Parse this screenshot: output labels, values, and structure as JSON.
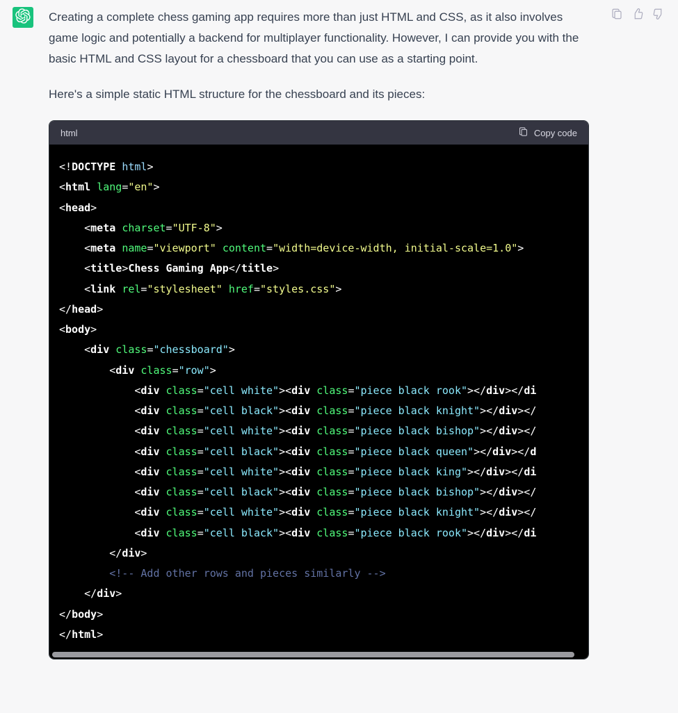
{
  "message": {
    "paragraph1": "Creating a complete chess gaming app requires more than just HTML and CSS, as it also involves game logic and potentially a backend for multiplayer functionality. However, I can provide you with the basic HTML and CSS layout for a chessboard that you can use as a starting point.",
    "paragraph2": "Here's a simple static HTML structure for the chessboard and its pieces:"
  },
  "code_block": {
    "language": "html",
    "copy_label": "Copy code",
    "lines": [
      [
        {
          "cls": "tok-punct",
          "t": "<!"
        },
        {
          "cls": "tok-tagw",
          "t": "DOCTYPE "
        },
        {
          "cls": "tok-doctype",
          "t": "html"
        },
        {
          "cls": "tok-punct",
          "t": ">"
        }
      ],
      [
        {
          "cls": "tok-punct",
          "t": "<"
        },
        {
          "cls": "tok-tagw",
          "t": "html"
        },
        {
          "cls": "",
          "t": " "
        },
        {
          "cls": "tok-attr",
          "t": "lang"
        },
        {
          "cls": "tok-punct",
          "t": "="
        },
        {
          "cls": "tok-val",
          "t": "\"en\""
        },
        {
          "cls": "tok-punct",
          "t": ">"
        }
      ],
      [
        {
          "cls": "tok-punct",
          "t": "<"
        },
        {
          "cls": "tok-tagw",
          "t": "head"
        },
        {
          "cls": "tok-punct",
          "t": ">"
        }
      ],
      [
        {
          "cls": "",
          "t": "    "
        },
        {
          "cls": "tok-punct",
          "t": "<"
        },
        {
          "cls": "tok-tagw",
          "t": "meta"
        },
        {
          "cls": "",
          "t": " "
        },
        {
          "cls": "tok-attr",
          "t": "charset"
        },
        {
          "cls": "tok-punct",
          "t": "="
        },
        {
          "cls": "tok-val",
          "t": "\"UTF-8\""
        },
        {
          "cls": "tok-punct",
          "t": ">"
        }
      ],
      [
        {
          "cls": "",
          "t": "    "
        },
        {
          "cls": "tok-punct",
          "t": "<"
        },
        {
          "cls": "tok-tagw",
          "t": "meta"
        },
        {
          "cls": "",
          "t": " "
        },
        {
          "cls": "tok-attr",
          "t": "name"
        },
        {
          "cls": "tok-punct",
          "t": "="
        },
        {
          "cls": "tok-val",
          "t": "\"viewport\""
        },
        {
          "cls": "",
          "t": " "
        },
        {
          "cls": "tok-attr",
          "t": "content"
        },
        {
          "cls": "tok-punct",
          "t": "="
        },
        {
          "cls": "tok-val",
          "t": "\"width=device-width, initial-scale=1.0\""
        },
        {
          "cls": "tok-punct",
          "t": ">"
        }
      ],
      [
        {
          "cls": "",
          "t": "    "
        },
        {
          "cls": "tok-punct",
          "t": "<"
        },
        {
          "cls": "tok-tagw",
          "t": "title"
        },
        {
          "cls": "tok-punct",
          "t": ">"
        },
        {
          "cls": "tok-text",
          "t": "Chess Gaming App"
        },
        {
          "cls": "tok-punct",
          "t": "</"
        },
        {
          "cls": "tok-tagw",
          "t": "title"
        },
        {
          "cls": "tok-punct",
          "t": ">"
        }
      ],
      [
        {
          "cls": "",
          "t": "    "
        },
        {
          "cls": "tok-punct",
          "t": "<"
        },
        {
          "cls": "tok-tagw",
          "t": "link"
        },
        {
          "cls": "",
          "t": " "
        },
        {
          "cls": "tok-attr",
          "t": "rel"
        },
        {
          "cls": "tok-punct",
          "t": "="
        },
        {
          "cls": "tok-val",
          "t": "\"stylesheet\""
        },
        {
          "cls": "",
          "t": " "
        },
        {
          "cls": "tok-attr",
          "t": "href"
        },
        {
          "cls": "tok-punct",
          "t": "="
        },
        {
          "cls": "tok-val",
          "t": "\"styles.css\""
        },
        {
          "cls": "tok-punct",
          "t": ">"
        }
      ],
      [
        {
          "cls": "tok-punct",
          "t": "</"
        },
        {
          "cls": "tok-tagw",
          "t": "head"
        },
        {
          "cls": "tok-punct",
          "t": ">"
        }
      ],
      [
        {
          "cls": "tok-punct",
          "t": "<"
        },
        {
          "cls": "tok-tagw",
          "t": "body"
        },
        {
          "cls": "tok-punct",
          "t": ">"
        }
      ],
      [
        {
          "cls": "",
          "t": "    "
        },
        {
          "cls": "tok-punct",
          "t": "<"
        },
        {
          "cls": "tok-tagw",
          "t": "div"
        },
        {
          "cls": "",
          "t": " "
        },
        {
          "cls": "tok-attr",
          "t": "class"
        },
        {
          "cls": "tok-punct",
          "t": "="
        },
        {
          "cls": "tok-valc",
          "t": "\"chessboard\""
        },
        {
          "cls": "tok-punct",
          "t": ">"
        }
      ],
      [
        {
          "cls": "",
          "t": "        "
        },
        {
          "cls": "tok-punct",
          "t": "<"
        },
        {
          "cls": "tok-tagw",
          "t": "div"
        },
        {
          "cls": "",
          "t": " "
        },
        {
          "cls": "tok-attr",
          "t": "class"
        },
        {
          "cls": "tok-punct",
          "t": "="
        },
        {
          "cls": "tok-valc",
          "t": "\"row\""
        },
        {
          "cls": "tok-punct",
          "t": ">"
        }
      ],
      [
        {
          "cls": "",
          "t": "            "
        },
        {
          "cls": "tok-punct",
          "t": "<"
        },
        {
          "cls": "tok-tagw",
          "t": "div"
        },
        {
          "cls": "",
          "t": " "
        },
        {
          "cls": "tok-attr",
          "t": "class"
        },
        {
          "cls": "tok-punct",
          "t": "="
        },
        {
          "cls": "tok-valc",
          "t": "\"cell white\""
        },
        {
          "cls": "tok-punct",
          "t": "><"
        },
        {
          "cls": "tok-tagw",
          "t": "div"
        },
        {
          "cls": "",
          "t": " "
        },
        {
          "cls": "tok-attr",
          "t": "class"
        },
        {
          "cls": "tok-punct",
          "t": "="
        },
        {
          "cls": "tok-valc",
          "t": "\"piece black rook\""
        },
        {
          "cls": "tok-punct",
          "t": "></"
        },
        {
          "cls": "tok-tagw",
          "t": "div"
        },
        {
          "cls": "tok-punct",
          "t": "></"
        },
        {
          "cls": "tok-tagw",
          "t": "di"
        }
      ],
      [
        {
          "cls": "",
          "t": "            "
        },
        {
          "cls": "tok-punct",
          "t": "<"
        },
        {
          "cls": "tok-tagw",
          "t": "div"
        },
        {
          "cls": "",
          "t": " "
        },
        {
          "cls": "tok-attr",
          "t": "class"
        },
        {
          "cls": "tok-punct",
          "t": "="
        },
        {
          "cls": "tok-valc",
          "t": "\"cell black\""
        },
        {
          "cls": "tok-punct",
          "t": "><"
        },
        {
          "cls": "tok-tagw",
          "t": "div"
        },
        {
          "cls": "",
          "t": " "
        },
        {
          "cls": "tok-attr",
          "t": "class"
        },
        {
          "cls": "tok-punct",
          "t": "="
        },
        {
          "cls": "tok-valc",
          "t": "\"piece black knight\""
        },
        {
          "cls": "tok-punct",
          "t": "></"
        },
        {
          "cls": "tok-tagw",
          "t": "div"
        },
        {
          "cls": "tok-punct",
          "t": "></"
        }
      ],
      [
        {
          "cls": "",
          "t": "            "
        },
        {
          "cls": "tok-punct",
          "t": "<"
        },
        {
          "cls": "tok-tagw",
          "t": "div"
        },
        {
          "cls": "",
          "t": " "
        },
        {
          "cls": "tok-attr",
          "t": "class"
        },
        {
          "cls": "tok-punct",
          "t": "="
        },
        {
          "cls": "tok-valc",
          "t": "\"cell white\""
        },
        {
          "cls": "tok-punct",
          "t": "><"
        },
        {
          "cls": "tok-tagw",
          "t": "div"
        },
        {
          "cls": "",
          "t": " "
        },
        {
          "cls": "tok-attr",
          "t": "class"
        },
        {
          "cls": "tok-punct",
          "t": "="
        },
        {
          "cls": "tok-valc",
          "t": "\"piece black bishop\""
        },
        {
          "cls": "tok-punct",
          "t": "></"
        },
        {
          "cls": "tok-tagw",
          "t": "div"
        },
        {
          "cls": "tok-punct",
          "t": "></"
        }
      ],
      [
        {
          "cls": "",
          "t": "            "
        },
        {
          "cls": "tok-punct",
          "t": "<"
        },
        {
          "cls": "tok-tagw",
          "t": "div"
        },
        {
          "cls": "",
          "t": " "
        },
        {
          "cls": "tok-attr",
          "t": "class"
        },
        {
          "cls": "tok-punct",
          "t": "="
        },
        {
          "cls": "tok-valc",
          "t": "\"cell black\""
        },
        {
          "cls": "tok-punct",
          "t": "><"
        },
        {
          "cls": "tok-tagw",
          "t": "div"
        },
        {
          "cls": "",
          "t": " "
        },
        {
          "cls": "tok-attr",
          "t": "class"
        },
        {
          "cls": "tok-punct",
          "t": "="
        },
        {
          "cls": "tok-valc",
          "t": "\"piece black queen\""
        },
        {
          "cls": "tok-punct",
          "t": "></"
        },
        {
          "cls": "tok-tagw",
          "t": "div"
        },
        {
          "cls": "tok-punct",
          "t": "></"
        },
        {
          "cls": "tok-tagw",
          "t": "d"
        }
      ],
      [
        {
          "cls": "",
          "t": "            "
        },
        {
          "cls": "tok-punct",
          "t": "<"
        },
        {
          "cls": "tok-tagw",
          "t": "div"
        },
        {
          "cls": "",
          "t": " "
        },
        {
          "cls": "tok-attr",
          "t": "class"
        },
        {
          "cls": "tok-punct",
          "t": "="
        },
        {
          "cls": "tok-valc",
          "t": "\"cell white\""
        },
        {
          "cls": "tok-punct",
          "t": "><"
        },
        {
          "cls": "tok-tagw",
          "t": "div"
        },
        {
          "cls": "",
          "t": " "
        },
        {
          "cls": "tok-attr",
          "t": "class"
        },
        {
          "cls": "tok-punct",
          "t": "="
        },
        {
          "cls": "tok-valc",
          "t": "\"piece black king\""
        },
        {
          "cls": "tok-punct",
          "t": "></"
        },
        {
          "cls": "tok-tagw",
          "t": "div"
        },
        {
          "cls": "tok-punct",
          "t": "></"
        },
        {
          "cls": "tok-tagw",
          "t": "di"
        }
      ],
      [
        {
          "cls": "",
          "t": "            "
        },
        {
          "cls": "tok-punct",
          "t": "<"
        },
        {
          "cls": "tok-tagw",
          "t": "div"
        },
        {
          "cls": "",
          "t": " "
        },
        {
          "cls": "tok-attr",
          "t": "class"
        },
        {
          "cls": "tok-punct",
          "t": "="
        },
        {
          "cls": "tok-valc",
          "t": "\"cell black\""
        },
        {
          "cls": "tok-punct",
          "t": "><"
        },
        {
          "cls": "tok-tagw",
          "t": "div"
        },
        {
          "cls": "",
          "t": " "
        },
        {
          "cls": "tok-attr",
          "t": "class"
        },
        {
          "cls": "tok-punct",
          "t": "="
        },
        {
          "cls": "tok-valc",
          "t": "\"piece black bishop\""
        },
        {
          "cls": "tok-punct",
          "t": "></"
        },
        {
          "cls": "tok-tagw",
          "t": "div"
        },
        {
          "cls": "tok-punct",
          "t": "></"
        }
      ],
      [
        {
          "cls": "",
          "t": "            "
        },
        {
          "cls": "tok-punct",
          "t": "<"
        },
        {
          "cls": "tok-tagw",
          "t": "div"
        },
        {
          "cls": "",
          "t": " "
        },
        {
          "cls": "tok-attr",
          "t": "class"
        },
        {
          "cls": "tok-punct",
          "t": "="
        },
        {
          "cls": "tok-valc",
          "t": "\"cell white\""
        },
        {
          "cls": "tok-punct",
          "t": "><"
        },
        {
          "cls": "tok-tagw",
          "t": "div"
        },
        {
          "cls": "",
          "t": " "
        },
        {
          "cls": "tok-attr",
          "t": "class"
        },
        {
          "cls": "tok-punct",
          "t": "="
        },
        {
          "cls": "tok-valc",
          "t": "\"piece black knight\""
        },
        {
          "cls": "tok-punct",
          "t": "></"
        },
        {
          "cls": "tok-tagw",
          "t": "div"
        },
        {
          "cls": "tok-punct",
          "t": "></"
        }
      ],
      [
        {
          "cls": "",
          "t": "            "
        },
        {
          "cls": "tok-punct",
          "t": "<"
        },
        {
          "cls": "tok-tagw",
          "t": "div"
        },
        {
          "cls": "",
          "t": " "
        },
        {
          "cls": "tok-attr",
          "t": "class"
        },
        {
          "cls": "tok-punct",
          "t": "="
        },
        {
          "cls": "tok-valc",
          "t": "\"cell black\""
        },
        {
          "cls": "tok-punct",
          "t": "><"
        },
        {
          "cls": "tok-tagw",
          "t": "div"
        },
        {
          "cls": "",
          "t": " "
        },
        {
          "cls": "tok-attr",
          "t": "class"
        },
        {
          "cls": "tok-punct",
          "t": "="
        },
        {
          "cls": "tok-valc",
          "t": "\"piece black rook\""
        },
        {
          "cls": "tok-punct",
          "t": "></"
        },
        {
          "cls": "tok-tagw",
          "t": "div"
        },
        {
          "cls": "tok-punct",
          "t": "></"
        },
        {
          "cls": "tok-tagw",
          "t": "di"
        }
      ],
      [
        {
          "cls": "",
          "t": "        "
        },
        {
          "cls": "tok-punct",
          "t": "</"
        },
        {
          "cls": "tok-tagw",
          "t": "div"
        },
        {
          "cls": "tok-punct",
          "t": ">"
        }
      ],
      [
        {
          "cls": "",
          "t": "        "
        },
        {
          "cls": "tok-comment",
          "t": "<!-- Add other rows and pieces similarly -->"
        }
      ],
      [
        {
          "cls": "",
          "t": "    "
        },
        {
          "cls": "tok-punct",
          "t": "</"
        },
        {
          "cls": "tok-tagw",
          "t": "div"
        },
        {
          "cls": "tok-punct",
          "t": ">"
        }
      ],
      [
        {
          "cls": "tok-punct",
          "t": "</"
        },
        {
          "cls": "tok-tagw",
          "t": "body"
        },
        {
          "cls": "tok-punct",
          "t": ">"
        }
      ],
      [
        {
          "cls": "tok-punct",
          "t": "</"
        },
        {
          "cls": "tok-tagw",
          "t": "html"
        },
        {
          "cls": "tok-punct",
          "t": ">"
        }
      ]
    ]
  }
}
